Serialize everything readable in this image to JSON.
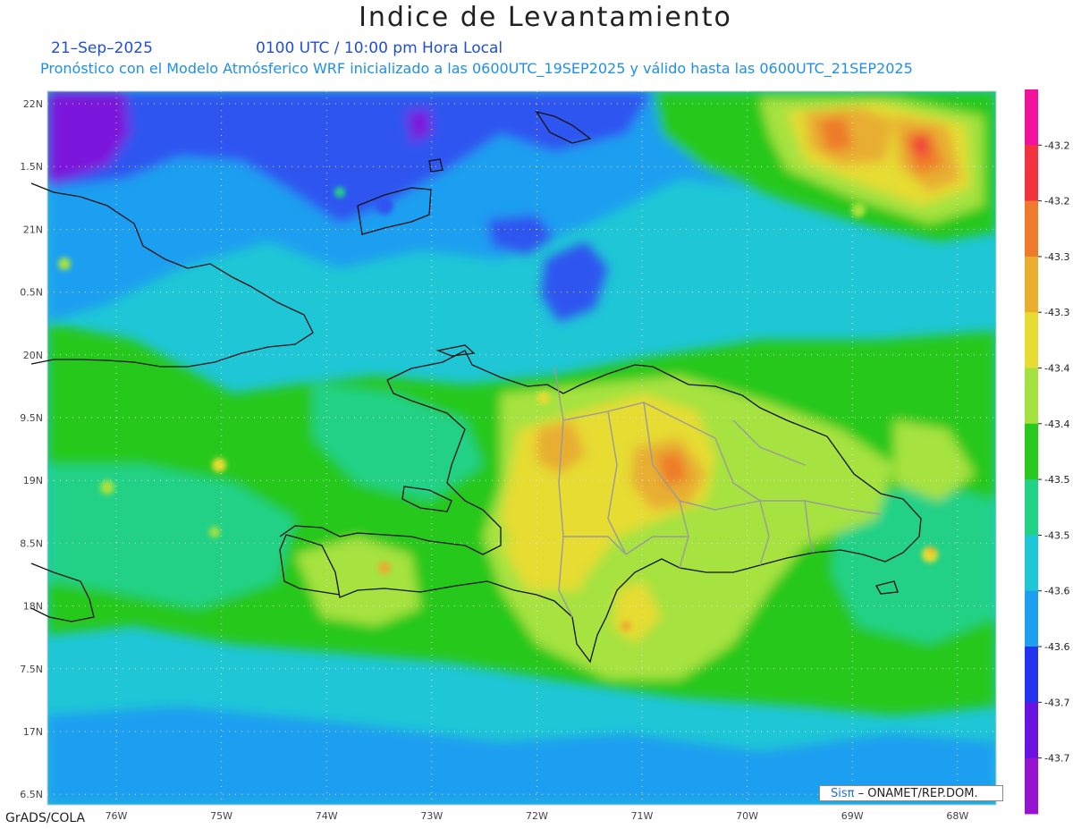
{
  "header": {
    "title": "Indice de Levantamiento",
    "date": "21–Sep–2025",
    "time": "0100 UTC / 10:00 pm Hora Local",
    "subtitle": "Pronóstico con el Modelo Atmósferico WRF inicializado a las 0600UTC_19SEP2025 y válido hasta las  0600UTC_21SEP2025"
  },
  "axes": {
    "lat_labels": [
      "22N",
      "1.5N",
      "21N",
      "0.5N",
      "20N",
      "9.5N",
      "19N",
      "8.5N",
      "18N",
      "7.5N",
      "17N",
      "6.5N"
    ],
    "lon_labels": [
      "76W",
      "75W",
      "74W",
      "73W",
      "72W",
      "71W",
      "70W",
      "69W",
      "68W"
    ]
  },
  "colorbar": {
    "labels": [
      "-43.2",
      "-43.2",
      "-43.3",
      "-43.3",
      "-43.4",
      "-43.4",
      "-43.5",
      "-43.5",
      "-43.6",
      "-43.6",
      "-43.7",
      "-43.7"
    ],
    "colors": [
      "#f0129a",
      "#f2333f",
      "#ee7a2b",
      "#e8ae30",
      "#e6dc33",
      "#a6e23f",
      "#28c81e",
      "#20d186",
      "#1fc6d6",
      "#1e9ff0",
      "#2433ee",
      "#6a13e0",
      "#9613cf"
    ]
  },
  "map_colors": {
    "ocean": "#1fc6d6",
    "blue": "#1e9ff0",
    "deep_blue": "#2f55f0",
    "purple": "#7b18dc",
    "green": "#28c81e",
    "teal": "#20d186",
    "light_green": "#a6e23f",
    "yellow": "#e6dc33",
    "gold": "#e8ae30",
    "orange": "#ee7a2b",
    "red": "#f2333f"
  },
  "credit": {
    "logo": "Sisπ",
    "text": " – ONAMET/REP.DOM."
  },
  "footer": {
    "software": "GrADS/COLA"
  }
}
